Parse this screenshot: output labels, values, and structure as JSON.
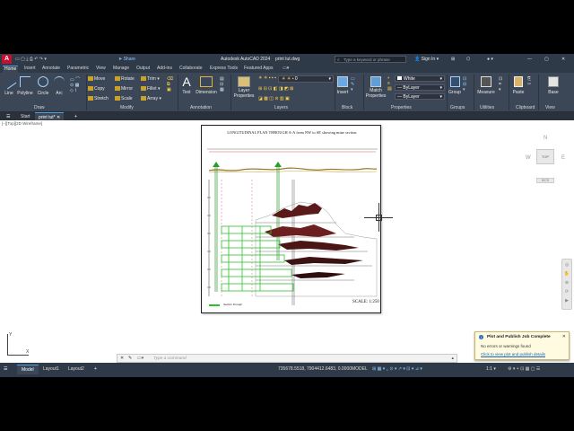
{
  "titlebar": {
    "app_title": "Autodesk AutoCAD 2024",
    "file_name": "print tut.dwg",
    "share_label": "Share",
    "search_placeholder": "Type a keyword or phrase",
    "sign_in_label": "Sign In"
  },
  "ribbon_tabs": [
    "Home",
    "Insert",
    "Annotate",
    "Parametric",
    "View",
    "Manage",
    "Output",
    "Add-ins",
    "Collaborate",
    "Express Tools",
    "Featured Apps"
  ],
  "ribbon": {
    "draw": {
      "line": "Line",
      "polyline": "Polyline",
      "circle": "Circle",
      "arc": "Arc",
      "panel": "Draw"
    },
    "modify": {
      "move": "Move",
      "rotate": "Rotate",
      "trim": "Trim",
      "copy": "Copy",
      "mirror": "Mirror",
      "fillet": "Fillet",
      "stretch": "Stretch",
      "scale": "Scale",
      "array": "Array",
      "panel": "Modify"
    },
    "annotation": {
      "text": "Text",
      "dimension": "Dimension",
      "panel": "Annotation"
    },
    "layers": {
      "layer_properties_1": "Layer",
      "layer_properties_2": "Properties",
      "layer_value": "0",
      "panel": "Layers"
    },
    "block": {
      "insert": "Insert",
      "panel": "Block"
    },
    "properties": {
      "match_1": "Match",
      "match_2": "Properties",
      "color": "White",
      "linetype": "ByLayer",
      "lineweight": "ByLayer",
      "panel": "Properties"
    },
    "groups": {
      "group": "Group",
      "panel": "Groups"
    },
    "utilities": {
      "measure": "Measure",
      "panel": "Utilities"
    },
    "clipboard": {
      "paste": "Paste",
      "panel": "Clipboard"
    },
    "view": {
      "base": "Base",
      "panel": "View"
    }
  },
  "file_tabs": {
    "start": "Start",
    "active": "print tut*"
  },
  "viewport_label": "[−][Top][2D Wireframe]",
  "drawing": {
    "title": "LONGITUDINAL PLAN THROUGH A-A from NW to SE showing mine section",
    "scale": "SCALE: 1:250",
    "legend": "Section through"
  },
  "viewcube": {
    "north": "N",
    "west": "W",
    "east": "E",
    "top": "TOP",
    "wcs": "WCS"
  },
  "command_line": {
    "placeholder": "Type a command"
  },
  "layout_tabs": [
    "Model",
    "Layout1",
    "Layout2"
  ],
  "status": {
    "coords": "735678.5518, 7904412.6483, 0.0000",
    "model": "MODEL",
    "scale": "1:1"
  },
  "notification": {
    "title": "Plot and Publish Job Complete",
    "body": "No errors or warnings found",
    "link": "Click to view plot and publish details"
  }
}
